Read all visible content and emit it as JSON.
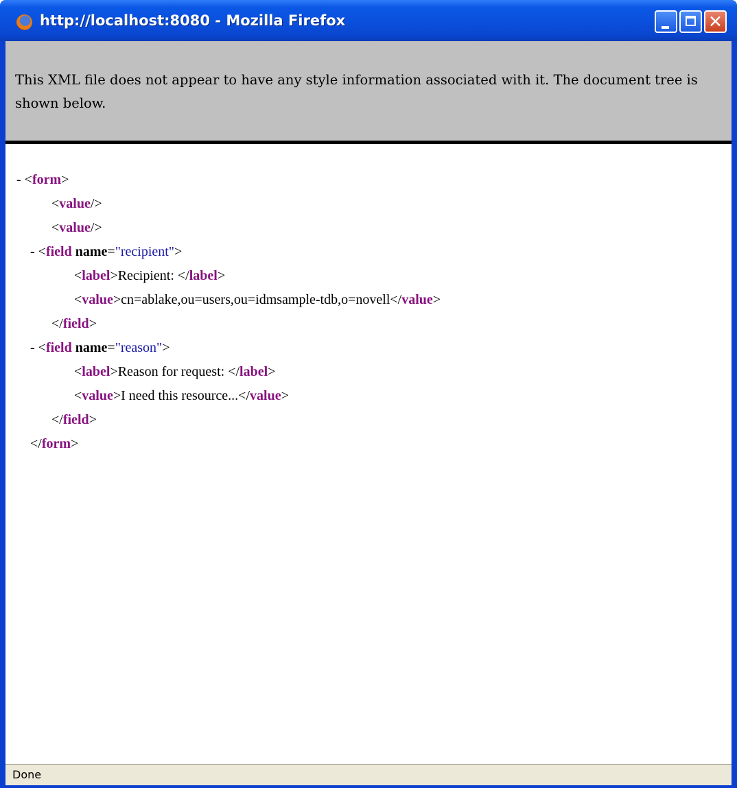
{
  "window": {
    "title": "http://localhost:8080 - Mozilla Firefox"
  },
  "notice": {
    "text": "This XML file does not appear to have any style information associated with it. The document tree is shown below."
  },
  "tree": {
    "dash": "-",
    "lt": "<",
    "gt": ">",
    "slash": "/",
    "eq": "=",
    "form_tag": "form",
    "value_tag": "value",
    "field_tag": "field",
    "label_tag": "label",
    "name_attr": "name",
    "recipient_attr_value": "\"recipient\"",
    "reason_attr_value": "\"reason\"",
    "recipient_label": "Recipient: ",
    "recipient_value": "cn=ablake,ou=users,ou=idmsample-tdb,o=novell",
    "reason_label": "Reason for request: ",
    "reason_value": "I need this resource..."
  },
  "status": {
    "text": "Done"
  }
}
